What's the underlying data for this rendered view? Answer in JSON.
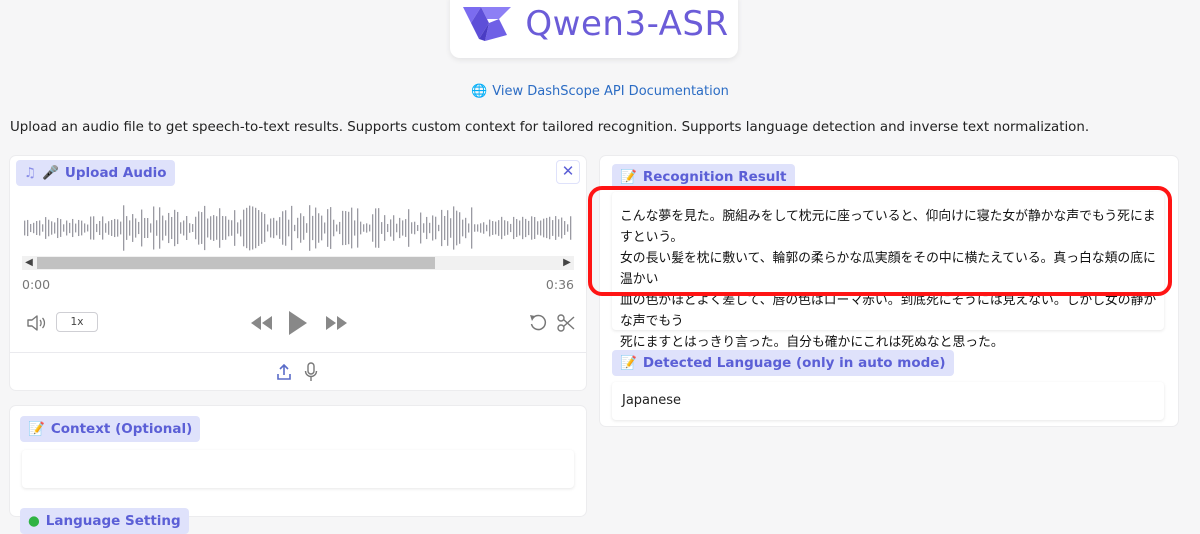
{
  "header": {
    "logo_text": "Qwen3-ASR",
    "doc_link_label": "View DashScope API Documentation",
    "description": "Upload an audio file to get speech-to-text results. Supports custom context for tailored recognition. Supports language detection and inverse text normalization."
  },
  "audio": {
    "label": "Upload Audio",
    "time_current": "0:00",
    "time_total": "0:36",
    "speed_label": "1x",
    "scroll_position": 0.73,
    "icons": [
      "music-note-icon",
      "microphone-emoji-icon",
      "close-icon",
      "volume-icon",
      "rewind-icon",
      "play-icon",
      "fast-forward-icon",
      "undo-icon",
      "scissors-icon",
      "upload-icon",
      "mic-icon"
    ]
  },
  "context": {
    "label": "Context (Optional)",
    "value": ""
  },
  "language_setting": {
    "label": "Language Setting"
  },
  "result": {
    "label": "Recognition Result",
    "lines": [
      "こんな夢を見た。腕組みをして枕元に座っていると、仰向けに寝た女が静かな声でもう死にますという。",
      "女の長い髪を枕に敷いて、輪郭の柔らかな瓜実顔をその中に横たえている。真っ白な頬の底に温かい",
      "血の色がほどよく差して、唇の色はローマ赤い。到底死にそうには見えない。しかし女の静かな声でもう",
      "死にますとはっきり言った。自分も確かにこれは死ぬなと思った。"
    ]
  },
  "detected_language": {
    "label": "Detected Language (only in auto mode)",
    "value": "Japanese"
  },
  "colors": {
    "accent": "#5b5fd6",
    "badge_bg": "#dfe2fb",
    "highlight": "#ff1414"
  }
}
